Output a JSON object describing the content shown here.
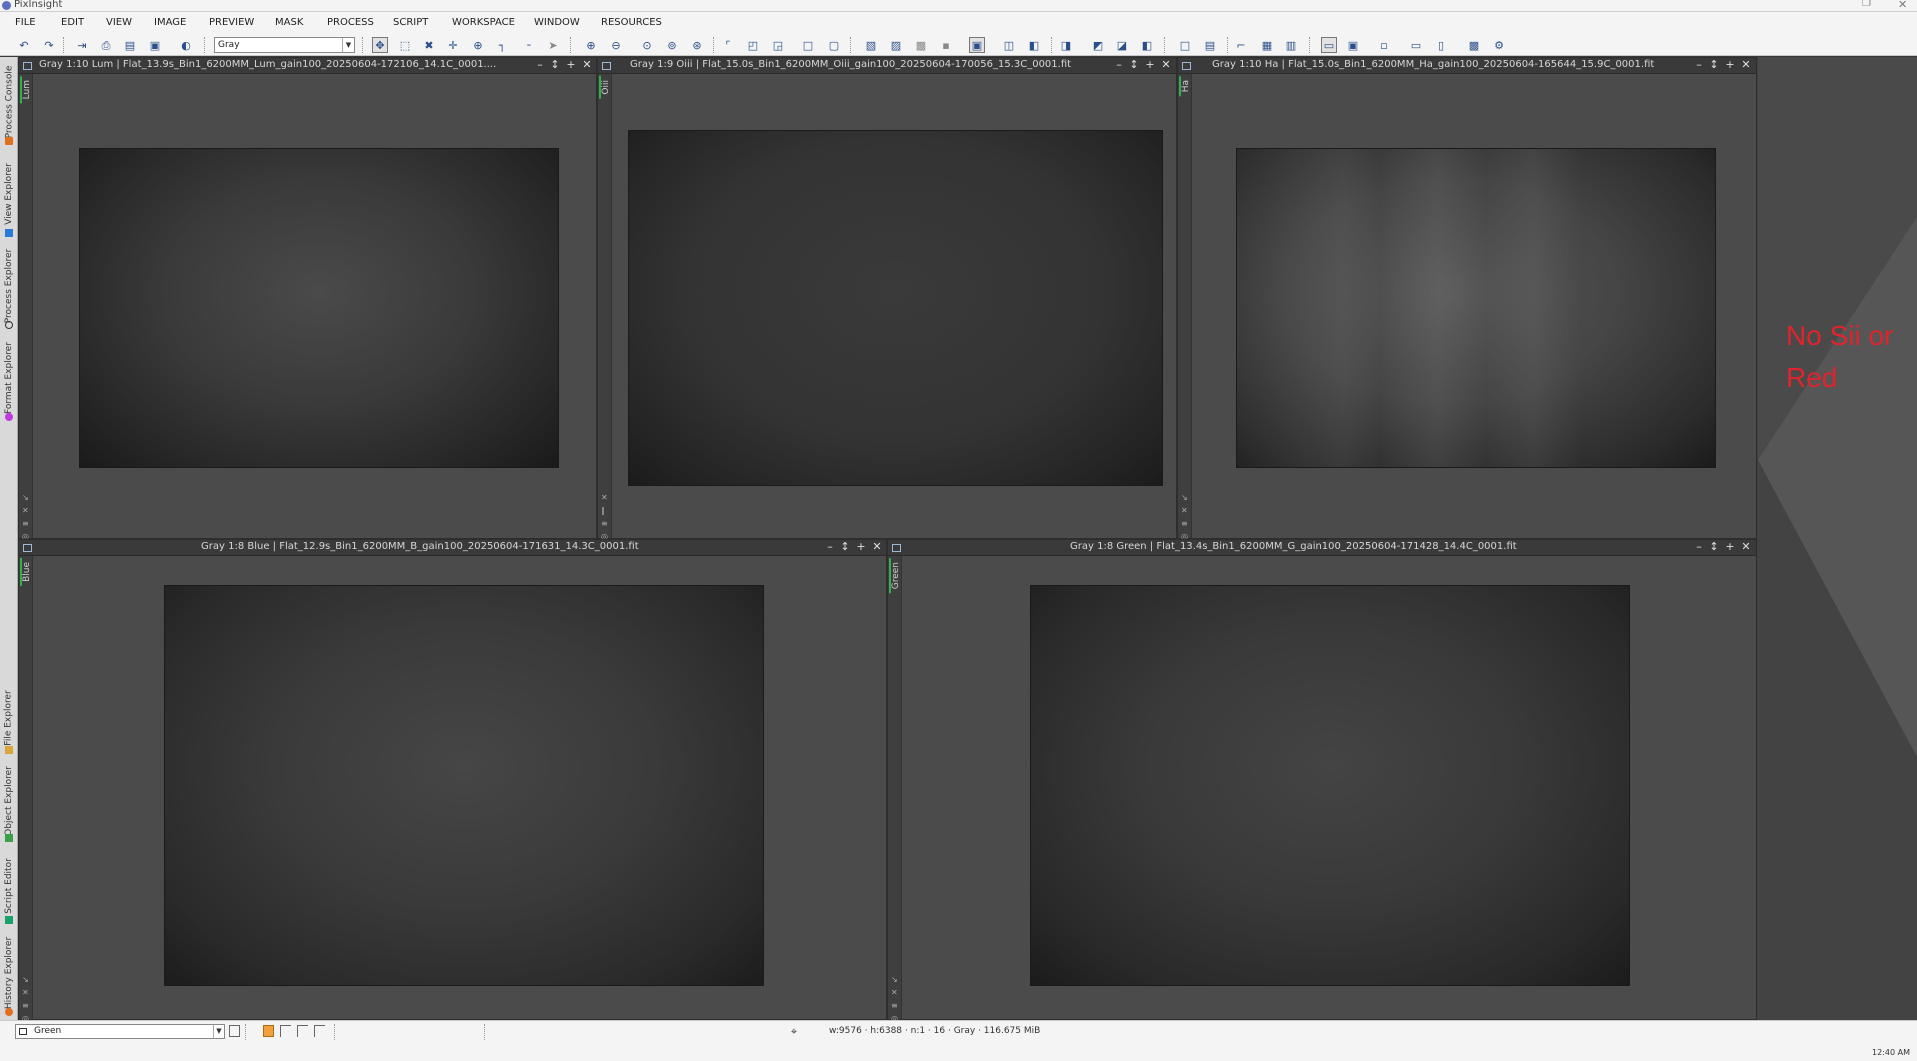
{
  "app": {
    "title": "PixInsight"
  },
  "menu": [
    "FILE",
    "EDIT",
    "VIEW",
    "IMAGE",
    "PREVIEW",
    "MASK",
    "PROCESS",
    "SCRIPT",
    "WORKSPACE",
    "WINDOW",
    "RESOURCES"
  ],
  "toolbar": {
    "colorspace_value": "Gray"
  },
  "side_tabs": [
    "Process Console",
    "View Explorer",
    "Process Explorer",
    "Format Explorer",
    "File Explorer",
    "Object Explorer",
    "Script Editor",
    "History Explorer"
  ],
  "windows": [
    {
      "title": "Gray 1:10 Lum | Flat_13.9s_Bin1_6200MM_Lum_gain100_20250604-172106_14.1C_0001....",
      "view_id": "Lum"
    },
    {
      "title": "Gray 1:9 Oiii | Flat_15.0s_Bin1_6200MM_Oiii_gain100_20250604-170056_15.3C_0001.fit",
      "view_id": "Oiii"
    },
    {
      "title": "Gray 1:10 Ha | Flat_15.0s_Bin1_6200MM_Ha_gain100_20250604-165644_15.9C_0001.fit",
      "view_id": "Ha"
    },
    {
      "title": "Gray 1:8 Blue | Flat_12.9s_Bin1_6200MM_B_gain100_20250604-171631_14.3C_0001.fit",
      "view_id": "Blue"
    },
    {
      "title": "Gray 1:8 Green | Flat_13.4s_Bin1_6200MM_G_gain100_20250604-171428_14.4C_0001.fit",
      "view_id": "Green"
    }
  ],
  "annotation": {
    "text": "No Sii or Red",
    "color": "#e0242d"
  },
  "status": {
    "view_selector": "Green",
    "info": "w:9576 · h:6388 · n:1 · 16 · Gray · 116.675 MiB"
  },
  "taskbar": {
    "clock": "12:40 AM"
  }
}
